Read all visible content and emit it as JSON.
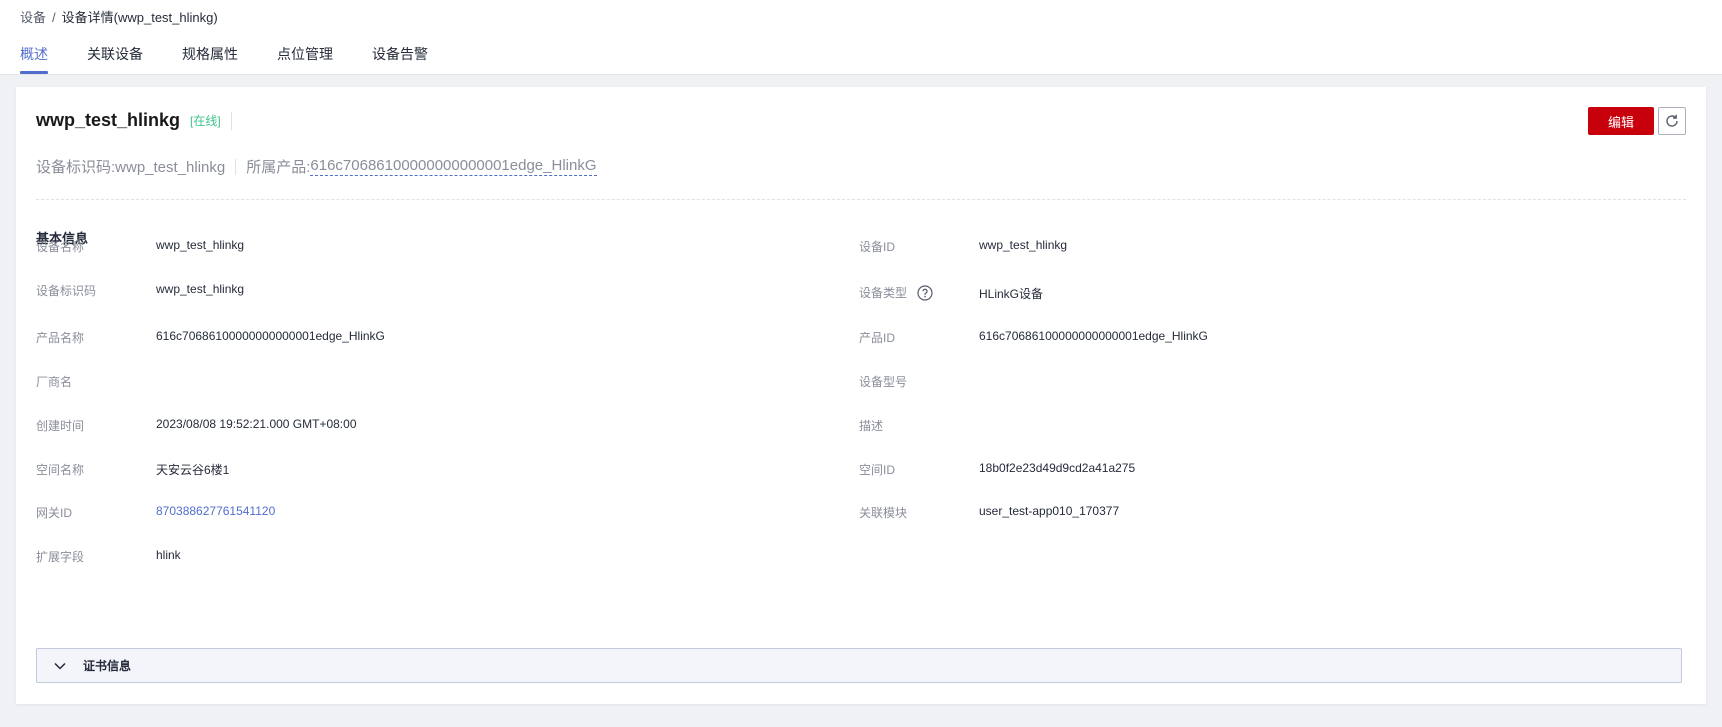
{
  "breadcrumb": {
    "root": "设备",
    "separator": "/",
    "current": "设备详情(wwp_test_hlinkg)"
  },
  "tabs": [
    "概述",
    "关联设备",
    "规格属性",
    "点位管理",
    "设备告警"
  ],
  "active_tab": "概述",
  "device": {
    "title": "wwp_test_hlinkg",
    "status": "[在线]",
    "identifier_line": "设备标识码:wwp_test_hlinkg",
    "product_prefix": "所属产品: ",
    "product_link": "616c70686100000000000001edge_HlinkG"
  },
  "actions": {
    "edit_label": "编辑",
    "refresh_icon": "refresh-icon"
  },
  "basic_info": {
    "title": "基本信息",
    "left": [
      {
        "label": "设备名称",
        "value": "wwp_test_hlinkg"
      },
      {
        "label": "设备标识码",
        "value": "wwp_test_hlinkg"
      },
      {
        "label": "产品名称",
        "value": "616c70686100000000000001edge_HlinkG"
      },
      {
        "label": "厂商名",
        "value": ""
      },
      {
        "label": "创建时间",
        "value": "2023/08/08 19:52:21.000 GMT+08:00"
      },
      {
        "label": "空间名称",
        "value": "天安云谷6楼1"
      },
      {
        "label": "网关ID",
        "value": "870388627761541120"
      },
      {
        "label": "扩展字段",
        "value": "hlink"
      }
    ],
    "right": [
      {
        "label": "设备ID",
        "value": "wwp_test_hlinkg"
      },
      {
        "label": "设备类型",
        "value": "HLinkG设备"
      },
      {
        "label": "产品ID",
        "value": "616c70686100000000000001edge_HlinkG"
      },
      {
        "label": "设备型号",
        "value": ""
      },
      {
        "label": "描述",
        "value": ""
      },
      {
        "label": "空间ID",
        "value": "18b0f2e23d49d9cd2a41a275"
      },
      {
        "label": "关联模块",
        "value": "user_test-app010_170377"
      }
    ]
  },
  "certificate": {
    "title": "证书信息"
  },
  "colors": {
    "accent": "#526ecc",
    "primary_button": "#c7000b",
    "online": "#3cc48a"
  }
}
